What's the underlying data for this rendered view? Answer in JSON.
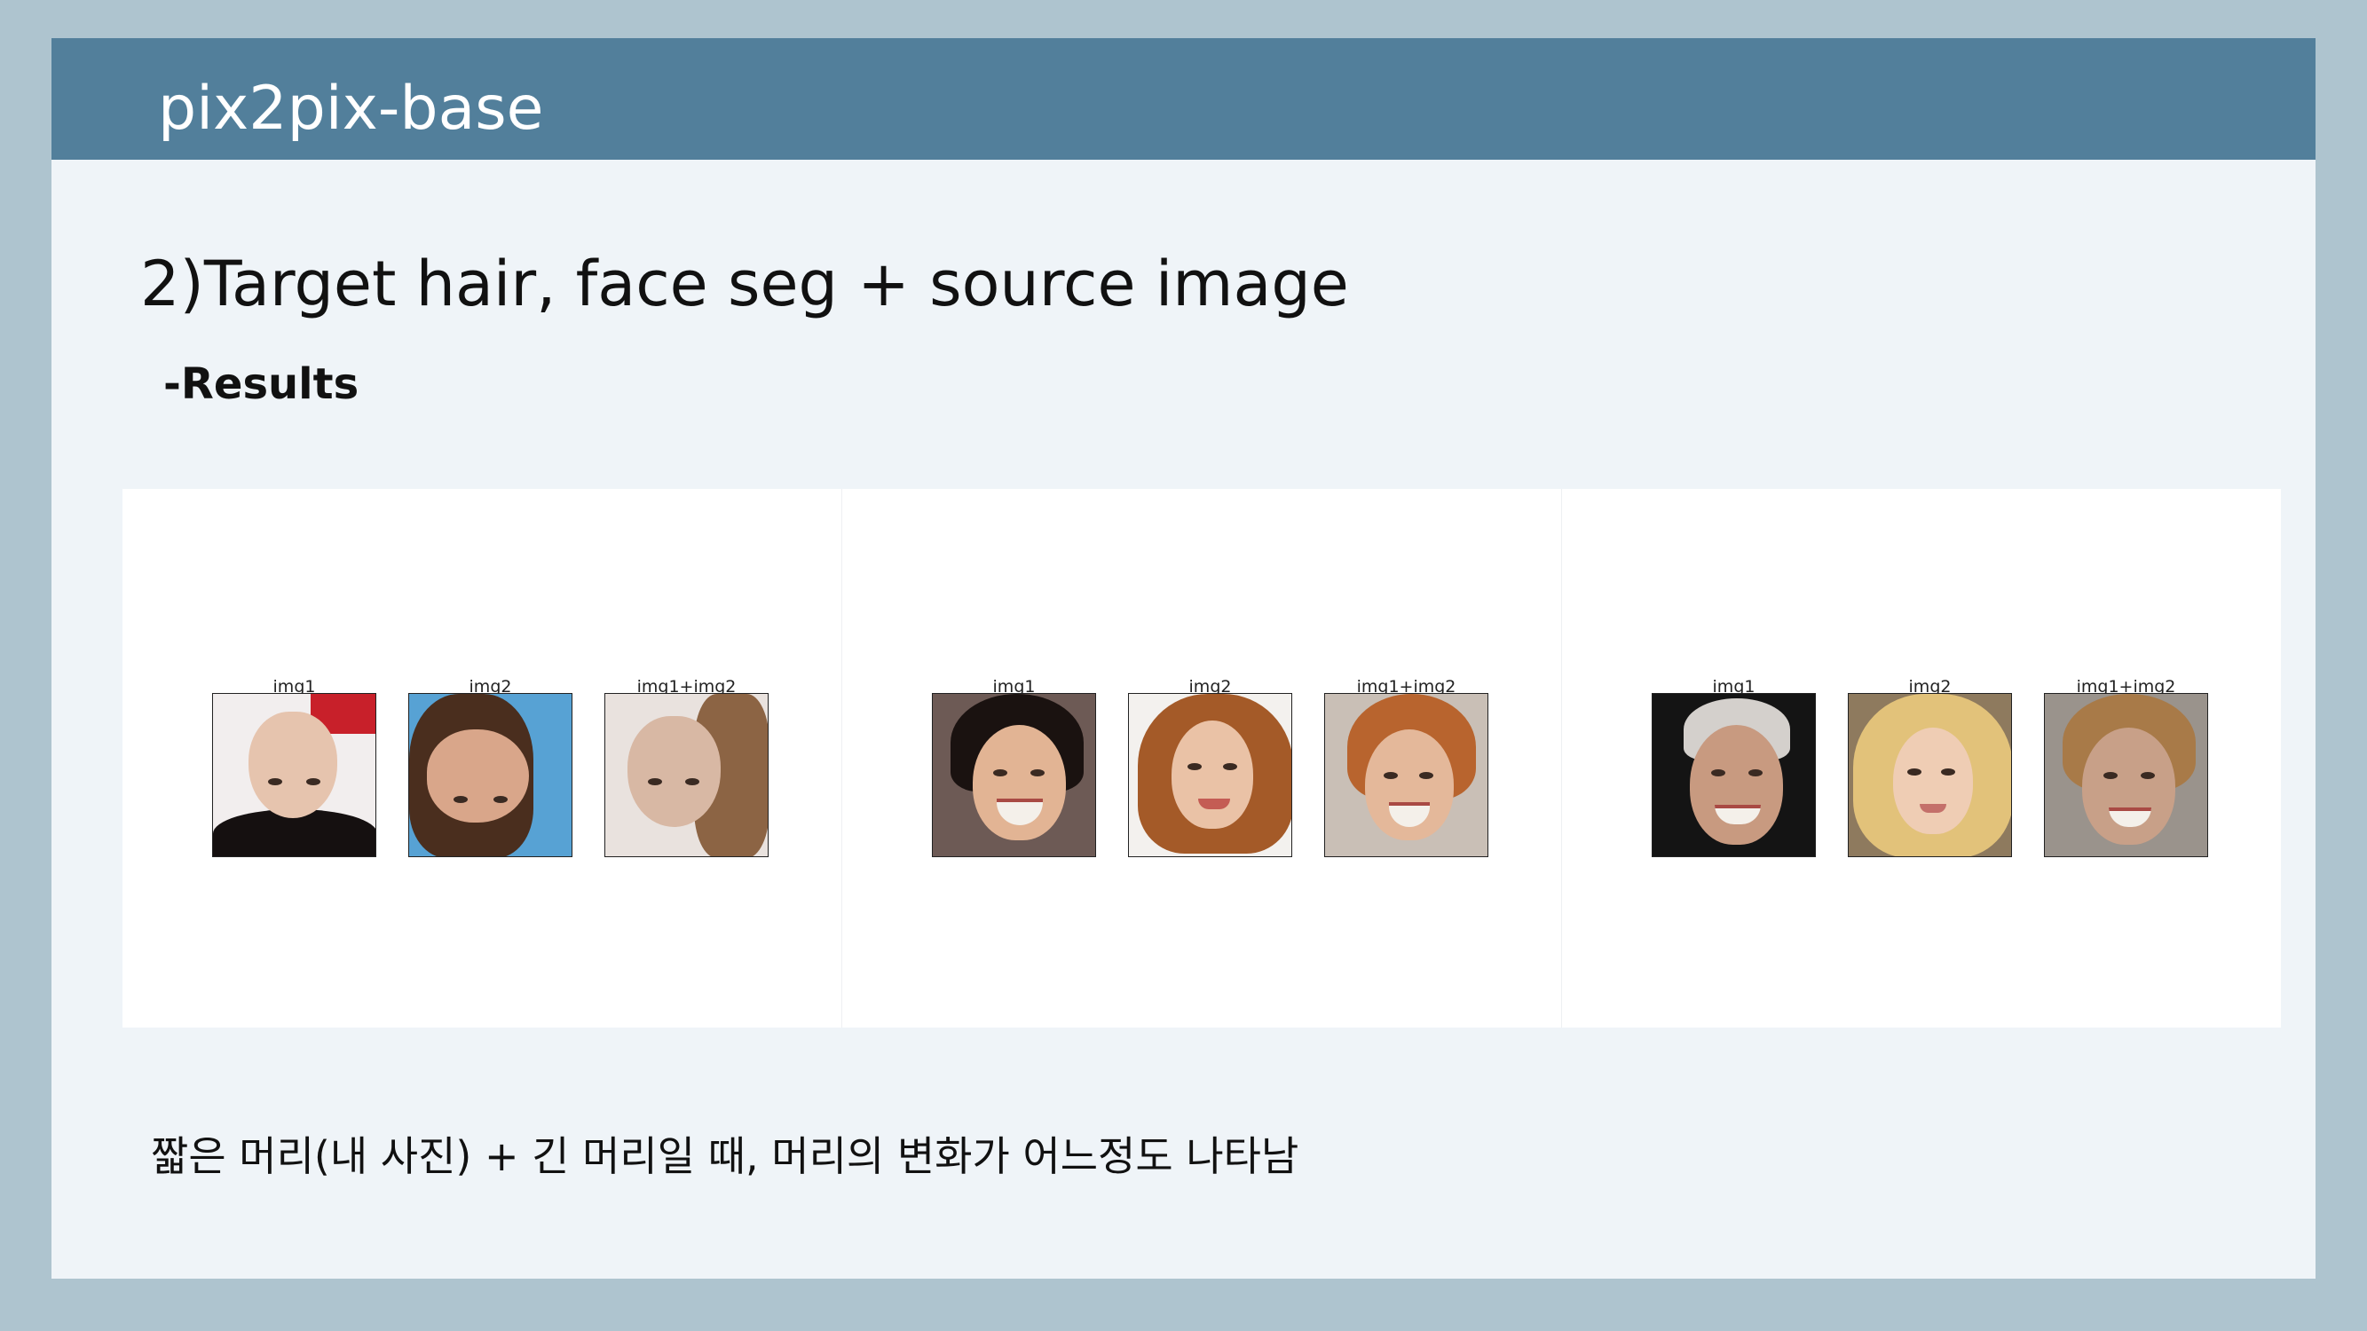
{
  "header": {
    "title": "pix2pix-base"
  },
  "heading": "2)Target hair, face seg + source image",
  "subheading": "-Results",
  "panels": [
    {
      "labels": [
        "img1",
        "img2",
        "img1+img2"
      ]
    },
    {
      "labels": [
        "img1",
        "img2",
        "img1+img2"
      ]
    },
    {
      "labels": [
        "img1",
        "img2",
        "img1+img2"
      ]
    }
  ],
  "caption": "짧은 머리(내 사진) + 긴 머리일 때,  머리의 변화가 어느정도 나타남",
  "colors": {
    "header": "#527f9b",
    "frame": "#aec4cf",
    "slide": "#eff4f8"
  }
}
